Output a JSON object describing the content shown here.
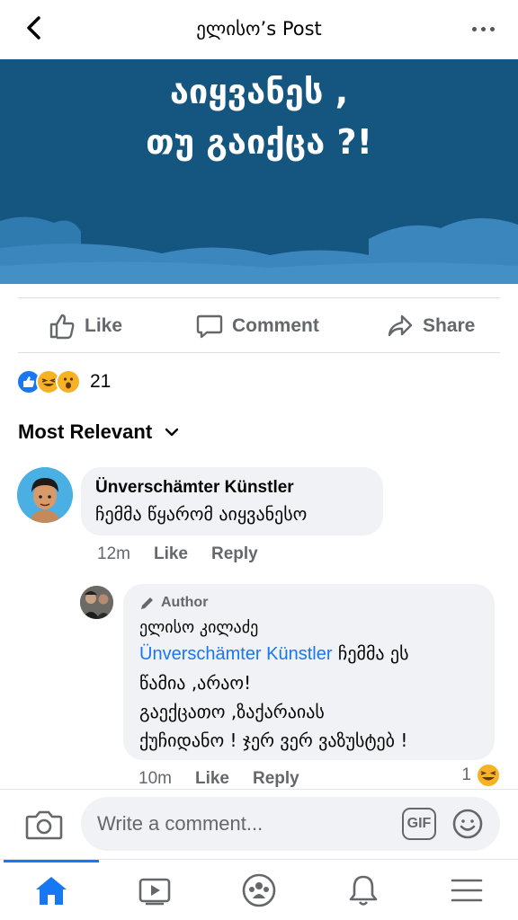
{
  "header": {
    "title": "ელისო’s Post"
  },
  "post": {
    "banner_line1": "აიყვანეს ,",
    "banner_line2": "თუ გაიქცა ?!",
    "banner_color": "#155680"
  },
  "actions": {
    "like": "Like",
    "comment": "Comment",
    "share": "Share"
  },
  "reactions": {
    "types": [
      "like",
      "haha",
      "wow"
    ],
    "count": "21"
  },
  "sort": {
    "label": "Most Relevant"
  },
  "comments": [
    {
      "author": "Ünverschämter Künstler",
      "text": "ჩემმა წყარომ აიყვანესო",
      "time": "12m",
      "like": "Like",
      "reply": "Reply"
    }
  ],
  "reply": {
    "badge": "Author",
    "author": "ელისო კილაძე",
    "mention": "Ünverschämter Künstler",
    "text_after_mention": " ჩემმა ეს",
    "line2": "წამია ,არაო!",
    "line3": "გაექცათო ,ზაქარაიას",
    "line4": "ქუჩიდანო ! ჯერ ვერ ვაზუსტებ !",
    "time": "10m",
    "like": "Like",
    "reply": "Reply",
    "reaction_count": "1"
  },
  "composer": {
    "placeholder": "Write a comment...",
    "gif": "GIF"
  },
  "colors": {
    "accent": "#1877f2",
    "bubble": "#f0f2f5",
    "muted_text": "#65676b"
  }
}
